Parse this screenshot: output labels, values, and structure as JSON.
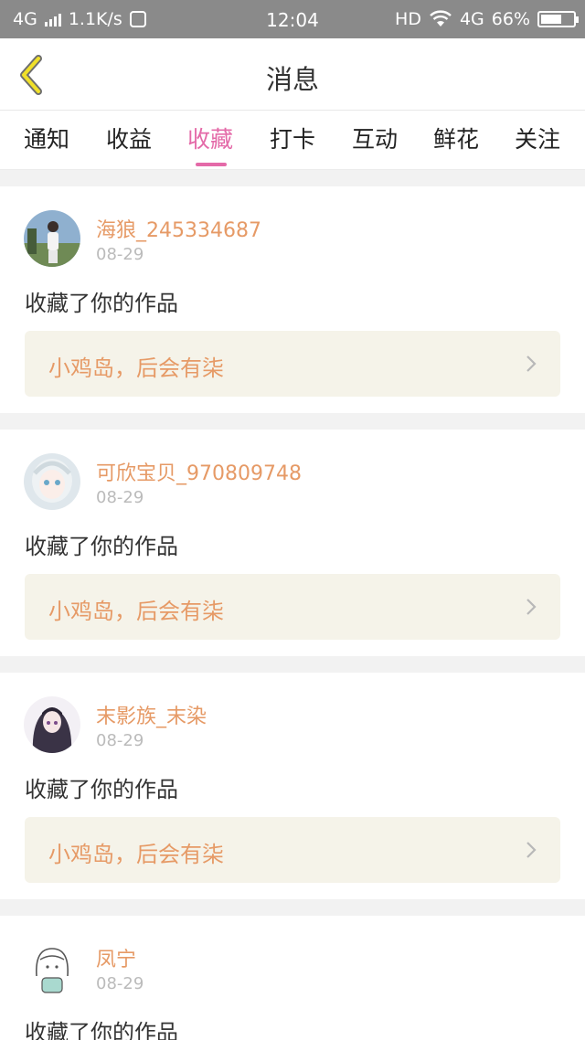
{
  "status_bar": {
    "network": "4G",
    "speed": "1.1K/s",
    "time": "12:04",
    "hd": "HD",
    "net2": "4G",
    "battery": "66%",
    "battery_level": 0.66
  },
  "header": {
    "title": "消息"
  },
  "tabs": [
    {
      "label": "通知"
    },
    {
      "label": "收益"
    },
    {
      "label": "收藏",
      "active": true
    },
    {
      "label": "打卡"
    },
    {
      "label": "互动"
    },
    {
      "label": "鲜花"
    },
    {
      "label": "关注"
    }
  ],
  "messages": [
    {
      "username": "海狼_245334687",
      "date": "08-29",
      "action": "收藏了你的作品",
      "work_title": "小鸡岛，后会有柒"
    },
    {
      "username": "可欣宝贝_970809748",
      "date": "08-29",
      "action": "收藏了你的作品",
      "work_title": "小鸡岛，后会有柒"
    },
    {
      "username": "末影族_末染",
      "date": "08-29",
      "action": "收藏了你的作品",
      "work_title": "小鸡岛，后会有柒"
    },
    {
      "username": "凤宁",
      "date": "08-29",
      "action": "收藏了你的作品"
    }
  ],
  "colors": {
    "accent": "#e46aa8",
    "username": "#e69a66",
    "work_bg": "#f5f3e9"
  }
}
